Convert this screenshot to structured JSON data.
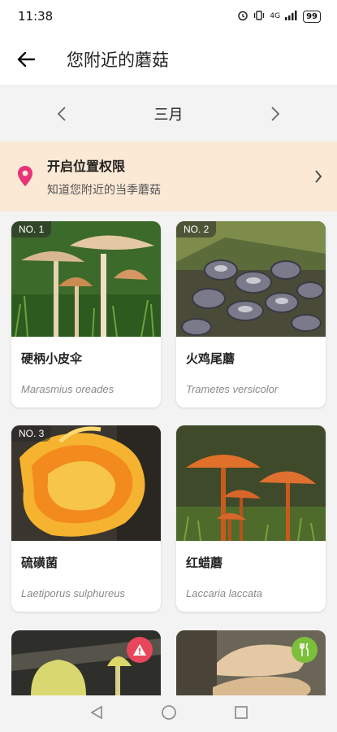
{
  "status_bar": {
    "time": "11:38",
    "network": "4G",
    "battery": "99"
  },
  "header": {
    "title": "您附近的蘑菇"
  },
  "month_selector": {
    "current": "三月"
  },
  "location_banner": {
    "title": "开启位置权限",
    "subtitle": "知道您附近的当季蘑菇"
  },
  "cards": [
    {
      "badge": "NO. 1",
      "name": "硬柄小皮伞",
      "latin": "Marasmius oreades"
    },
    {
      "badge": "NO. 2",
      "name": "火鸡尾蘑",
      "latin": "Trametes versicolor"
    },
    {
      "badge": "NO. 3",
      "name": "硫磺菌",
      "latin": "Laetiporus sulphureus"
    },
    {
      "badge": "",
      "name": "红蜡蘑",
      "latin": "Laccaria laccata"
    }
  ],
  "partial_cards": [
    {
      "indicator": "warning-icon",
      "color": "#e8465b"
    },
    {
      "indicator": "edible-icon",
      "color": "#7cbf3a"
    }
  ]
}
